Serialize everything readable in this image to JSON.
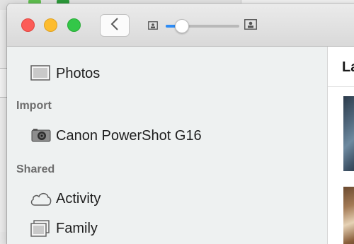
{
  "window": {
    "traffic_lights": {
      "close_color": "#fc5c57",
      "minimize_color": "#fdbc2e",
      "zoom_color": "#33c748"
    },
    "toolbar": {
      "back_icon": "chevron-left-icon",
      "zoom_slider": {
        "value_fraction": 0.22,
        "accent_color": "#2e8cf5"
      }
    }
  },
  "sidebar": {
    "items": [
      {
        "label": "Photos",
        "icon": "photos-icon"
      },
      {
        "label": "Canon PowerShot G16",
        "icon": "camera-icon"
      },
      {
        "label": "Activity",
        "icon": "cloud-icon"
      },
      {
        "label": "Family",
        "icon": "shared-album-icon"
      }
    ],
    "sections": {
      "import": "Import",
      "shared": "Shared"
    }
  },
  "content": {
    "title_partial": "La"
  }
}
